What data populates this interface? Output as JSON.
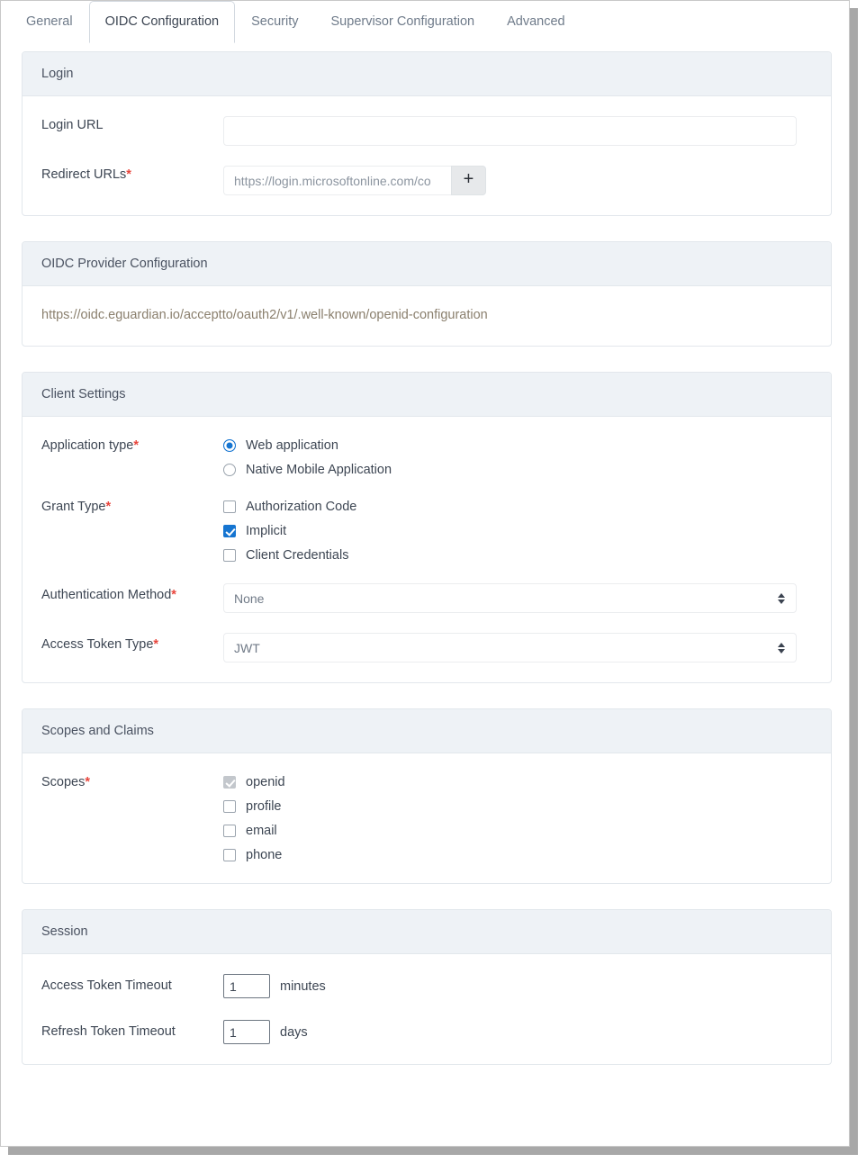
{
  "tabs": [
    {
      "label": "General",
      "active": false
    },
    {
      "label": "OIDC Configuration",
      "active": true
    },
    {
      "label": "Security",
      "active": false
    },
    {
      "label": "Supervisor Configuration",
      "active": false
    },
    {
      "label": "Advanced",
      "active": false
    }
  ],
  "login_panel": {
    "title": "Login",
    "login_url": {
      "label": "Login URL",
      "value": "",
      "placeholder": ""
    },
    "redirect_urls": {
      "label": "Redirect URLs",
      "required": "*",
      "value": "",
      "placeholder": "https://login.microsoftonline.com/co",
      "add_button": "+"
    }
  },
  "provider_panel": {
    "title": "OIDC Provider Configuration",
    "url": "https://oidc.eguardian.io/acceptto/oauth2/v1/.well-known/openid-configuration"
  },
  "client_panel": {
    "title": "Client Settings",
    "application_type": {
      "label": "Application type",
      "required": "*",
      "options": [
        {
          "label": "Web application",
          "selected": true
        },
        {
          "label": "Native Mobile Application",
          "selected": false
        }
      ]
    },
    "grant_type": {
      "label": "Grant Type",
      "required": "*",
      "options": [
        {
          "label": "Authorization Code",
          "checked": false
        },
        {
          "label": "Implicit",
          "checked": true
        },
        {
          "label": "Client Credentials",
          "checked": false
        }
      ]
    },
    "authentication_method": {
      "label": "Authentication Method",
      "required": "*",
      "value": "None"
    },
    "access_token_type": {
      "label": "Access Token Type",
      "required": "*",
      "value": "JWT"
    }
  },
  "scopes_panel": {
    "title": "Scopes and Claims",
    "scopes": {
      "label": "Scopes",
      "required": "*",
      "options": [
        {
          "label": "openid",
          "checked": true,
          "disabled": true
        },
        {
          "label": "profile",
          "checked": false,
          "disabled": false
        },
        {
          "label": "email",
          "checked": false,
          "disabled": false
        },
        {
          "label": "phone",
          "checked": false,
          "disabled": false
        }
      ]
    }
  },
  "session_panel": {
    "title": "Session",
    "access_token_timeout": {
      "label": "Access Token Timeout",
      "value": "1",
      "unit": "minutes"
    },
    "refresh_token_timeout": {
      "label": "Refresh Token Timeout",
      "value": "1",
      "unit": "days"
    }
  },
  "colors": {
    "accent": "#1675d1",
    "required": "#e8453c",
    "panel_header_bg": "#eef2f6",
    "link": "#8a7f6d"
  }
}
